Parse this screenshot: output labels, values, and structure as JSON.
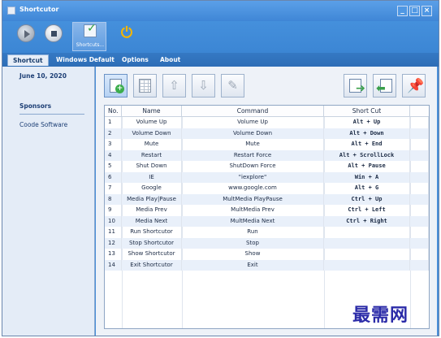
{
  "window": {
    "title": "Shortcutor",
    "controls": [
      "_",
      "□",
      "×"
    ]
  },
  "ribbon": {
    "shortcut_label": "Shortcuts..."
  },
  "tabs": [
    {
      "label": "Shortcut",
      "active": true
    },
    {
      "label": "Windows Default",
      "active": false
    },
    {
      "label": "Options",
      "active": false
    },
    {
      "label": "About",
      "active": false
    }
  ],
  "sidebar": {
    "date": "June 10, 2020",
    "sponsors_heading": "Sponsors",
    "sponsor_item": "Coode Software"
  },
  "table": {
    "headers": {
      "no": "No.",
      "name": "Name",
      "command": "Command",
      "shortcut": "Short Cut"
    },
    "rows": [
      {
        "no": "1",
        "name": "Volume Up",
        "command": "Volume Up",
        "shortcut": "Alt + Up"
      },
      {
        "no": "2",
        "name": "Volume Down",
        "command": "Volume Down",
        "shortcut": "Alt + Down"
      },
      {
        "no": "3",
        "name": "Mute",
        "command": "Mute",
        "shortcut": "Alt + End"
      },
      {
        "no": "4",
        "name": "Restart",
        "command": "Restart Force",
        "shortcut": "Alt + ScrollLock"
      },
      {
        "no": "5",
        "name": "Shut Down",
        "command": "ShutDown Force",
        "shortcut": "Alt + Pause"
      },
      {
        "no": "6",
        "name": "IE",
        "command": "\"iexplore\"",
        "shortcut": "Win + A"
      },
      {
        "no": "7",
        "name": "Google",
        "command": "www.google.com",
        "shortcut": "Alt + G"
      },
      {
        "no": "8",
        "name": "Media Play|Pause",
        "command": "MultMedia PlayPause",
        "shortcut": "Ctrl + Up"
      },
      {
        "no": "9",
        "name": "Media Prev",
        "command": "MultMedia Prev",
        "shortcut": "Ctrl + Left"
      },
      {
        "no": "10",
        "name": "Media Next",
        "command": "MultMedia Next",
        "shortcut": "Ctrl + Right"
      },
      {
        "no": "11",
        "name": "Run Shortcutor",
        "command": "Run",
        "shortcut": ""
      },
      {
        "no": "12",
        "name": "Stop Shortcutor",
        "command": "Stop",
        "shortcut": ""
      },
      {
        "no": "13",
        "name": "Show Shortcutor",
        "command": "Show",
        "shortcut": ""
      },
      {
        "no": "14",
        "name": "Exit Shortcutor",
        "command": "Exit",
        "shortcut": ""
      }
    ]
  },
  "watermark": "最需网",
  "colors": {
    "titlebar": "#4a8fd8",
    "panel": "#e4ecf7",
    "row_alt": "#e9f0fa"
  }
}
